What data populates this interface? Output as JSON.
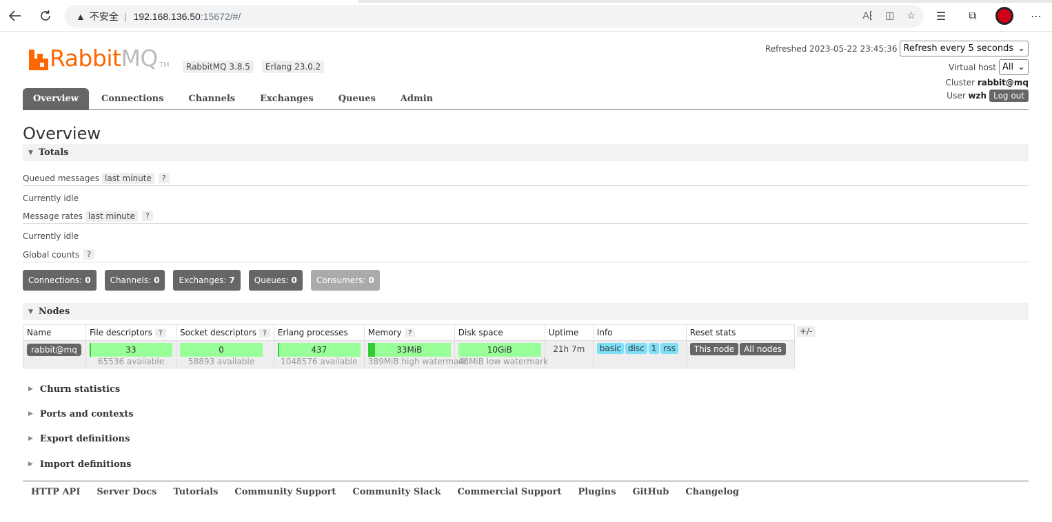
{
  "browser": {
    "insecure_label": "不安全",
    "url_host": "192.168.136.50",
    "url_path": ":15672/#/"
  },
  "app": {
    "logo_rabbit": "Rabbit",
    "logo_mq": "MQ",
    "logo_tm": "TM",
    "version_rabbitmq": "RabbitMQ 3.8.5",
    "version_erlang": "Erlang 23.0.2"
  },
  "header": {
    "refreshed_label": "Refreshed 2023-05-22 23:45:36",
    "refresh_select": "Refresh every 5 seconds",
    "vhost_label": "Virtual host",
    "vhost_select": "All",
    "cluster_label": "Cluster",
    "cluster_value": "rabbit@mq",
    "user_label": "User",
    "user_value": "wzh",
    "logout_label": "Log out"
  },
  "tabs": [
    {
      "label": "Overview",
      "active": true
    },
    {
      "label": "Connections",
      "active": false
    },
    {
      "label": "Channels",
      "active": false
    },
    {
      "label": "Exchanges",
      "active": false
    },
    {
      "label": "Queues",
      "active": false
    },
    {
      "label": "Admin",
      "active": false
    }
  ],
  "page_title": "Overview",
  "totals": {
    "section_title": "Totals",
    "queued_messages_label": "Queued messages",
    "queued_period": "last minute",
    "help": "?",
    "queued_status": "Currently idle",
    "message_rates_label": "Message rates",
    "rates_period": "last minute",
    "rates_status": "Currently idle",
    "global_counts_label": "Global counts",
    "counts": [
      {
        "label": "Connections:",
        "value": "0"
      },
      {
        "label": "Channels:",
        "value": "0"
      },
      {
        "label": "Exchanges:",
        "value": "7"
      },
      {
        "label": "Queues:",
        "value": "0"
      },
      {
        "label": "Consumers:",
        "value": "0"
      }
    ]
  },
  "nodes": {
    "section_title": "Nodes",
    "columns": [
      "Name",
      "File descriptors",
      "Socket descriptors",
      "Erlang processes",
      "Memory",
      "Disk space",
      "Uptime",
      "Info",
      "Reset stats"
    ],
    "plus_minus": "+/-",
    "row": {
      "name": "rabbit@mq",
      "file_descriptors": "33",
      "file_descriptors_avail": "65536 available",
      "file_descriptors_fraction": 0.0005,
      "socket_descriptors": "0",
      "socket_descriptors_avail": "58893 available",
      "socket_descriptors_fraction": 0,
      "erlang_processes": "437",
      "erlang_processes_avail": "1048576 available",
      "erlang_processes_fraction": 0.0004,
      "memory": "33MiB",
      "memory_watermark": "389MiB high watermark",
      "memory_fraction": 0.085,
      "disk_space": "10GiB",
      "disk_watermark": "48MiB low watermark",
      "uptime": "21h 7m",
      "info_tags": [
        "basic",
        "disc",
        "1",
        "rss"
      ],
      "reset_this_node": "This node",
      "reset_all_nodes": "All nodes"
    }
  },
  "collapsed_sections": [
    "Churn statistics",
    "Ports and contexts",
    "Export definitions",
    "Import definitions"
  ],
  "footer_links": [
    "HTTP API",
    "Server Docs",
    "Tutorials",
    "Community Support",
    "Community Slack",
    "Commercial Support",
    "Plugins",
    "GitHub",
    "Changelog"
  ],
  "colors": {
    "brand_orange": "#ff6600",
    "tab_active_bg": "#666666",
    "bar_green": "#99ff99",
    "info_blue": "#7de0f8"
  }
}
